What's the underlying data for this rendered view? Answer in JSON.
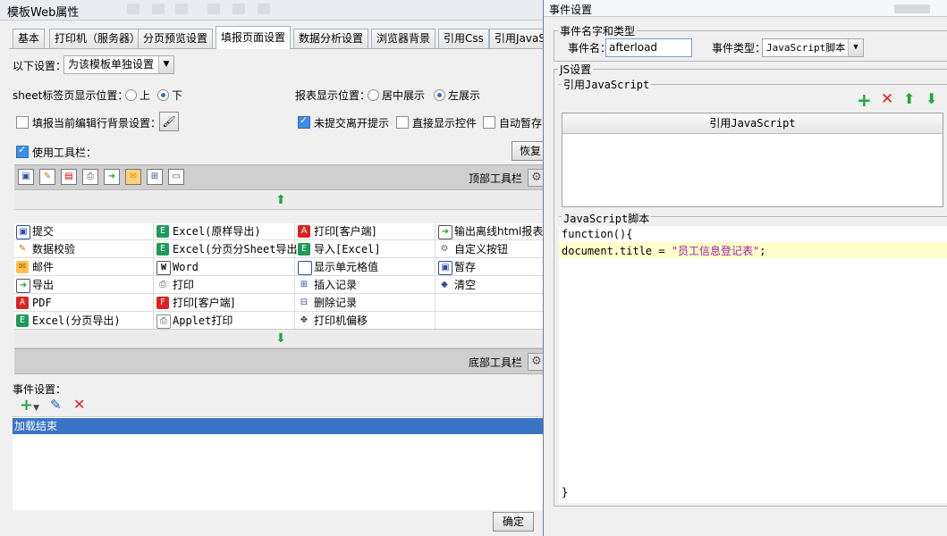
{
  "left_dialog": {
    "title": "模板Web属性",
    "tabs": [
      "基本",
      "打印机（服务器）",
      "分页预览设置",
      "填报页面设置",
      "数据分析设置",
      "浏览器背景",
      "引用Css",
      "引用JavaS"
    ],
    "active_tab": "填报页面设置",
    "settings_scope_label": "以下设置：",
    "settings_scope_value": "为该模板单独设置",
    "sheet_tab_position_label": "sheet标签页显示位置：",
    "sheet_tab_options": [
      "上",
      "下"
    ],
    "sheet_tab_selected": "下",
    "report_display_label": "报表显示位置：",
    "report_display_options": [
      "居中展示",
      "左展示"
    ],
    "report_display_selected": "左展示",
    "options": {
      "fill_bg_label": "填报当前编辑行背景设置：",
      "unsubmitted_label": "未提交离开提示",
      "direct_controls_label": "直接显示控件",
      "auto_save_label": "自动暂存"
    },
    "use_toolbar_label": "使用工具栏：",
    "restore_button": "恢复",
    "top_toolbar_label": "顶部工具栏",
    "bottom_toolbar_label": "底部工具栏",
    "toolbar_icons": [
      "save-icon",
      "check-icon",
      "pdf-icon",
      "print-icon",
      "export-icon",
      "mail-icon",
      "insert-icon",
      "cell-icon"
    ],
    "buttons_grid": [
      [
        "提交",
        "Excel(原样导出)",
        "打印[客户端]",
        "输出离线html报表"
      ],
      [
        "数据校验",
        "Excel(分页分Sheet导出)",
        "导入[Excel]",
        "自定义按钮"
      ],
      [
        "邮件",
        "Word",
        "显示单元格值",
        "暂存"
      ],
      [
        "导出",
        "打印",
        "插入记录",
        "清空"
      ],
      [
        "PDF",
        "打印[客户端]",
        "删除记录",
        ""
      ],
      [
        "Excel(分页导出)",
        "Applet打印",
        "打印机偏移",
        ""
      ]
    ],
    "event_settings_label": "事件设置：",
    "events": [
      "加载结束"
    ],
    "ok_button": "确定"
  },
  "right_dialog": {
    "title": "事件设置",
    "name_type_group": "事件名字和类型",
    "event_name_label": "事件名：",
    "event_name_value": "afterload",
    "event_type_label": "事件类型：",
    "event_type_value": "JavaScript脚本",
    "js_settings_group": "JS设置",
    "ref_js_group": "引用JavaScript",
    "ref_js_column": "引用JavaScript",
    "script_group": "JavaScript脚本",
    "code": {
      "line1": "function(){",
      "line2_prefix": "document.title = ",
      "line2_string": "\"员工信息登记表\"",
      "line2_suffix": ";",
      "line3": "}"
    }
  },
  "colors": {
    "selection": "#3874c4",
    "code_highlight": "#ffffcc",
    "green_action": "#1ea83a",
    "red_action": "#e02020"
  }
}
